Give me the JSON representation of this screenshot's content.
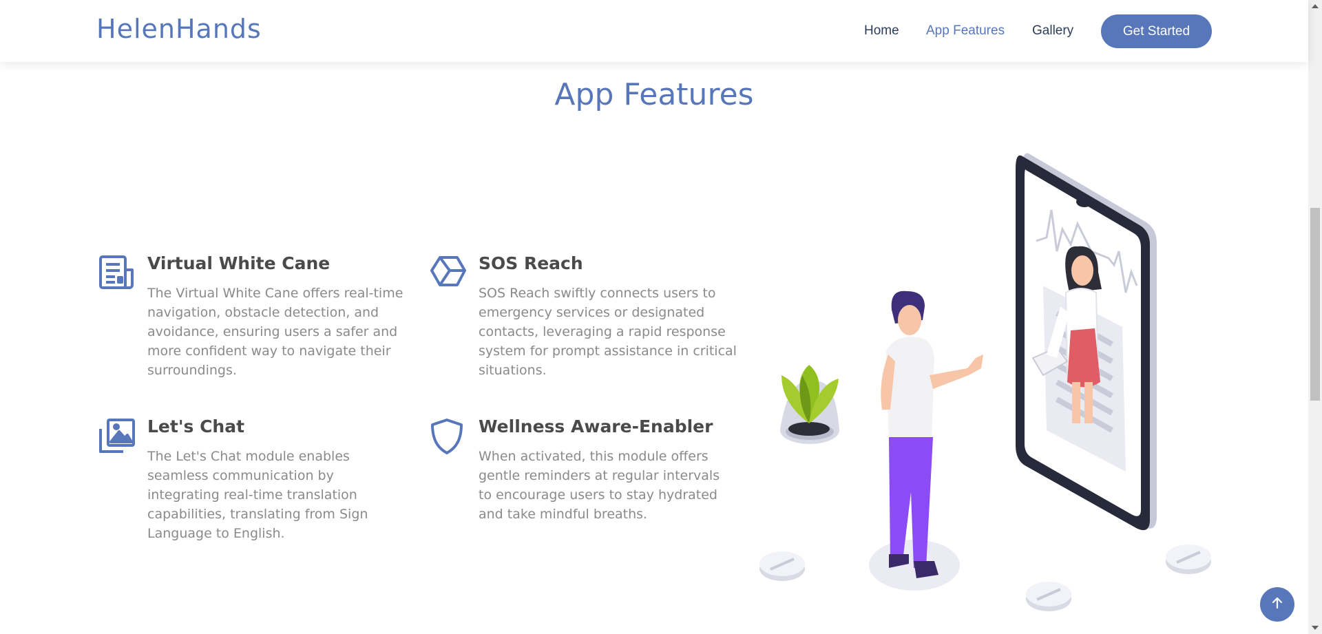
{
  "brand": {
    "name": "HelenHands",
    "accent": "#5777ba",
    "text_dark": "#2e3d57",
    "muted": "#8a8a8a"
  },
  "nav": {
    "items": [
      {
        "label": "Home",
        "active": false
      },
      {
        "label": "App Features",
        "active": true
      },
      {
        "label": "Gallery",
        "active": false
      }
    ],
    "cta_label": "Get Started"
  },
  "section": {
    "title": "App Features"
  },
  "features": [
    {
      "icon": "newspaper-icon",
      "title": "Virtual White Cane",
      "description": "The Virtual White Cane offers real-time navigation, obstacle detection, and avoidance, ensuring users a safer and more confident way to navigate their surroundings."
    },
    {
      "icon": "cube-icon",
      "title": "SOS Reach",
      "description": "SOS Reach swiftly connects users to emergency services or designated contacts, leveraging a rapid response system for prompt assistance in critical situations."
    },
    {
      "icon": "images-icon",
      "title": "Let's Chat",
      "description": "The Let's Chat module enables seamless communication by integrating real-time translation capabilities, translating from Sign Language to English."
    },
    {
      "icon": "shield-icon",
      "title": "Wellness Aware-Enabler",
      "description": "When activated, this module offers gentle reminders at regular intervals to encourage users to stay hydrated and take mindful breaths."
    }
  ],
  "back_to_top": {
    "icon": "arrow-up-icon"
  },
  "illustration": {
    "icon": "telemedicine-illustration"
  }
}
